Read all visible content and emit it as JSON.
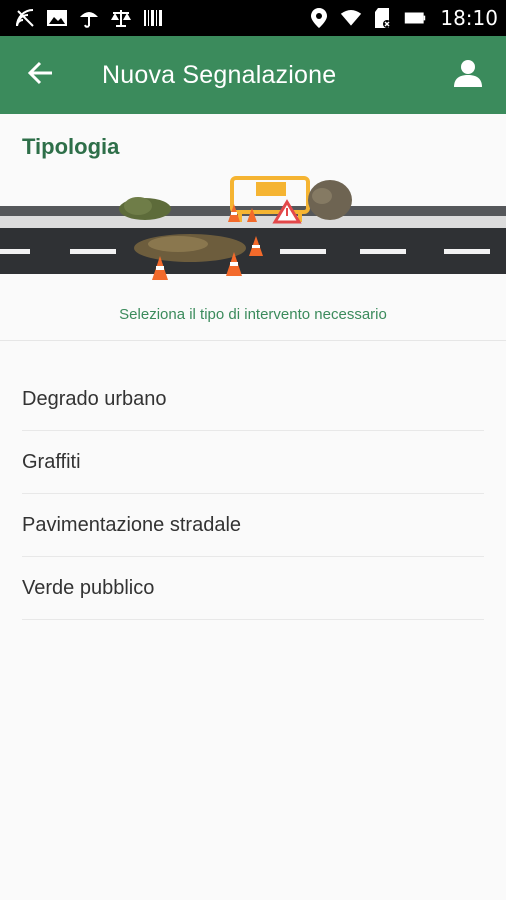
{
  "statusbar": {
    "time": "18:10",
    "icons_left": [
      "no-signal-icon",
      "image-icon",
      "umbrella-icon",
      "scale-icon",
      "barcode-icon"
    ],
    "icons_right": [
      "location-icon",
      "wifi-icon",
      "sd-card-icon",
      "battery-icon"
    ]
  },
  "appbar": {
    "title": "Nuova Segnalazione",
    "color": "#3b8b5c"
  },
  "section": {
    "title": "Tipologia",
    "hint": "Seleziona il tipo di intervento necessario"
  },
  "list": {
    "items": [
      {
        "label": "Degrado urbano"
      },
      {
        "label": "Graffiti"
      },
      {
        "label": "Pavimentazione stradale"
      },
      {
        "label": "Verde pubblico"
      }
    ]
  }
}
